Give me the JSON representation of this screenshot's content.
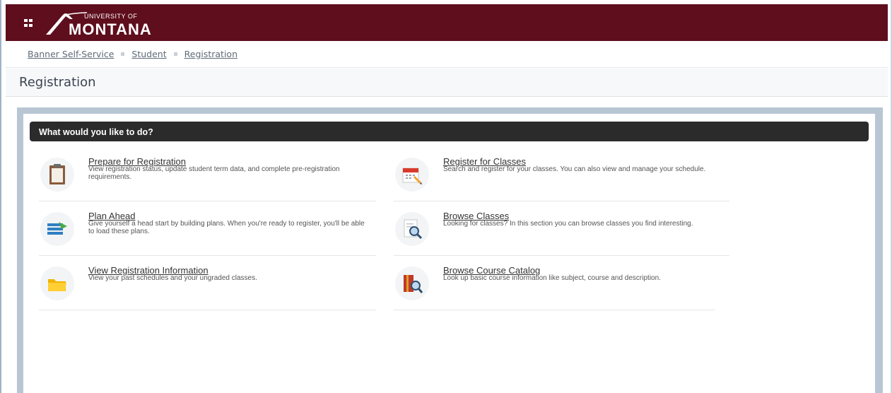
{
  "app": {
    "logo_small": "UNIVERSITY OF",
    "logo_big": "MONTANA"
  },
  "breadcrumb": {
    "items": [
      "Banner Self-Service",
      "Student",
      "Registration"
    ]
  },
  "page": {
    "title": "Registration"
  },
  "panel": {
    "heading": "What would you like to do?",
    "items": [
      {
        "title": "Prepare for Registration",
        "desc": "View registration status, update student term data, and complete pre-registration requirements.",
        "icon": "clipboard-icon"
      },
      {
        "title": "Register for Classes",
        "desc": "Search and register for your classes. You can also view and manage your schedule.",
        "icon": "calendar-pencil-icon"
      },
      {
        "title": "Plan Ahead",
        "desc": "Give yourself a head start by building plans. When you're ready to register, you'll be able to load these plans.",
        "icon": "plan-list-icon"
      },
      {
        "title": "Browse Classes",
        "desc": "Looking for classes? In this section you can browse classes you find interesting.",
        "icon": "document-search-icon"
      },
      {
        "title": "View Registration Information",
        "desc": "View your past schedules and your ungraded classes.",
        "icon": "folder-icon"
      },
      {
        "title": "Browse Course Catalog",
        "desc": "Look up basic course information like subject, course and description.",
        "icon": "book-search-icon"
      }
    ]
  },
  "colors": {
    "brand": "#5e0e1d",
    "header_bar": "#2b2b2b",
    "panel_border": "#b8c6d4"
  }
}
